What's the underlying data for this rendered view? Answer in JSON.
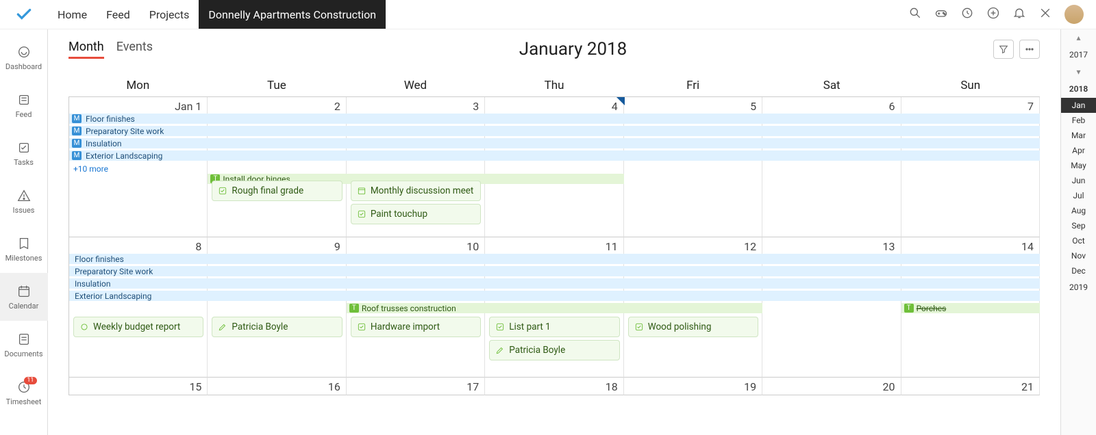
{
  "topnav": {
    "items": [
      "Home",
      "Feed",
      "Projects",
      "Donnelly Apartments Construction"
    ],
    "active_index": 3
  },
  "sidebar": {
    "items": [
      {
        "label": "Dashboard"
      },
      {
        "label": "Feed"
      },
      {
        "label": "Tasks"
      },
      {
        "label": "Issues"
      },
      {
        "label": "Milestones"
      },
      {
        "label": "Calendar"
      },
      {
        "label": "Documents"
      },
      {
        "label": "Timesheet",
        "badge": "11"
      }
    ],
    "active_index": 5
  },
  "viewtabs": {
    "items": [
      "Month",
      "Events"
    ],
    "active_index": 0
  },
  "title": "January 2018",
  "dow": [
    "Mon",
    "Tue",
    "Wed",
    "Thu",
    "Fri",
    "Sat",
    "Sun"
  ],
  "yearbar": {
    "years": [
      "2017",
      "2018",
      "2019"
    ],
    "current_year": "2018",
    "months": [
      "Jan",
      "Feb",
      "Mar",
      "Apr",
      "May",
      "Jun",
      "Jul",
      "Aug",
      "Sep",
      "Oct",
      "Nov",
      "Dec"
    ],
    "selected_month": "Jan"
  },
  "week1": {
    "daynums": [
      "Jan 1",
      "2",
      "3",
      "4",
      "5",
      "6",
      "7"
    ],
    "marker_index": 3,
    "marker_value": "4",
    "allday": [
      {
        "kind": "M",
        "label": "Floor finishes"
      },
      {
        "kind": "M",
        "label": "Preparatory Site work"
      },
      {
        "kind": "M",
        "label": "Insulation"
      },
      {
        "kind": "M",
        "label": "Exterior Landscaping"
      }
    ],
    "more": "+10 more",
    "green_span": {
      "label": "Install door hinges",
      "from_col": 1,
      "to_col": 3
    },
    "col1_items": [
      {
        "icon": "check",
        "label": "Rough final grade"
      }
    ],
    "col2_items": [
      {
        "icon": "cal",
        "label": "Monthly discussion meet"
      },
      {
        "icon": "check",
        "label": "Paint touchup"
      }
    ]
  },
  "week2": {
    "daynums": [
      "8",
      "9",
      "10",
      "11",
      "12",
      "13",
      "14"
    ],
    "allday": [
      {
        "label": "Floor finishes"
      },
      {
        "label": "Preparatory Site work"
      },
      {
        "label": "Insulation"
      },
      {
        "label": "Exterior Landscaping"
      }
    ],
    "green_span": {
      "label": "Roof trusses construction",
      "from_col": 2,
      "to_col": 4
    },
    "green_right": {
      "label": "Porches",
      "from_col": 6,
      "to_col": 6,
      "crossed": true
    },
    "col0_items": [
      {
        "icon": "circle",
        "label": "Weekly budget report"
      }
    ],
    "col1_items": [
      {
        "icon": "pen",
        "label": "Patricia Boyle"
      }
    ],
    "col2_items": [
      {
        "icon": "check",
        "label": "Hardware import"
      }
    ],
    "col3_items": [
      {
        "icon": "check",
        "label": "List part 1"
      },
      {
        "icon": "pen",
        "label": "Patricia Boyle"
      }
    ],
    "col4_items": [
      {
        "icon": "check",
        "label": "Wood polishing"
      }
    ]
  },
  "week3": {
    "daynums": [
      "15",
      "16",
      "17",
      "18",
      "19",
      "20",
      "21"
    ]
  }
}
